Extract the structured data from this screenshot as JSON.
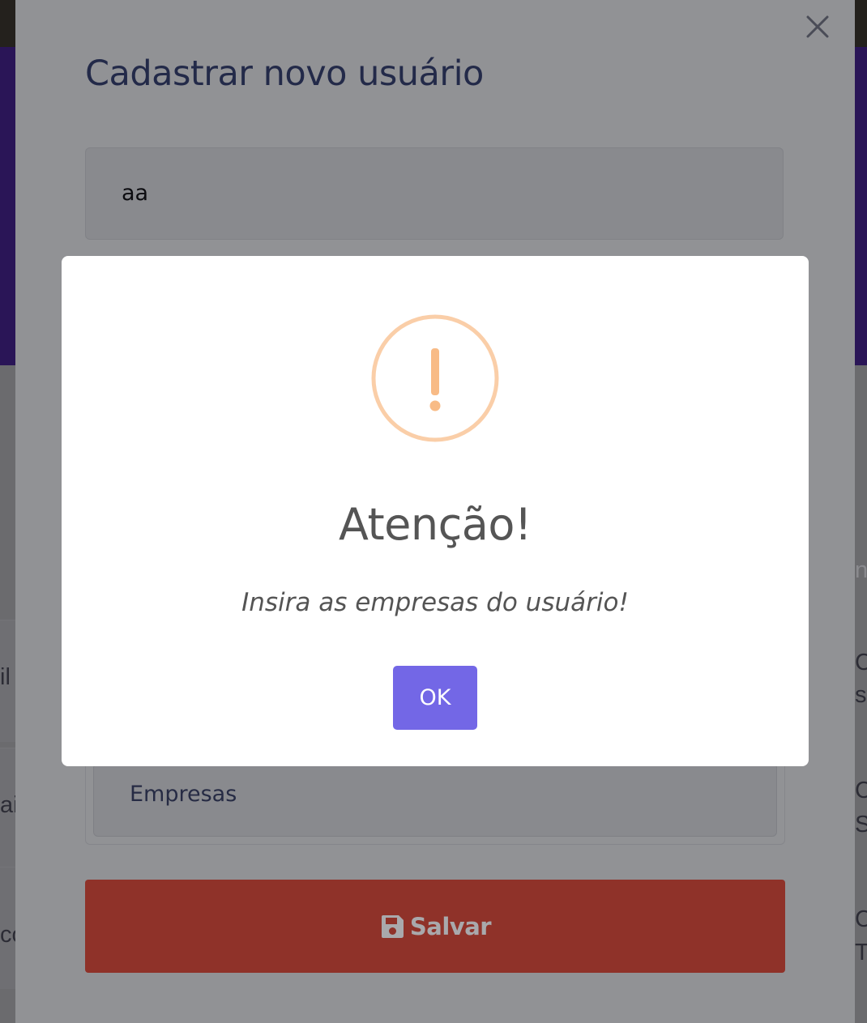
{
  "modal": {
    "title": "Cadastrar novo usuário",
    "name_field_value": "aa",
    "companies_label": "Empresas",
    "save_label": "Salvar"
  },
  "alert": {
    "title": "Atenção!",
    "message": "Insira as empresas do usuário!",
    "ok_label": "OK",
    "icon": "warning-icon"
  },
  "background": {
    "left_edge_fragments": [
      "il",
      "ai",
      "co"
    ],
    "right_edge_fragments": [
      "n",
      "Co",
      "st",
      "Co",
      "Se",
      "Co",
      "Tc"
    ]
  },
  "colors": {
    "alert_icon": "#f8bb86",
    "ok_button": "#7367e6",
    "save_button": "#8f3229",
    "title_text": "#232a49"
  }
}
